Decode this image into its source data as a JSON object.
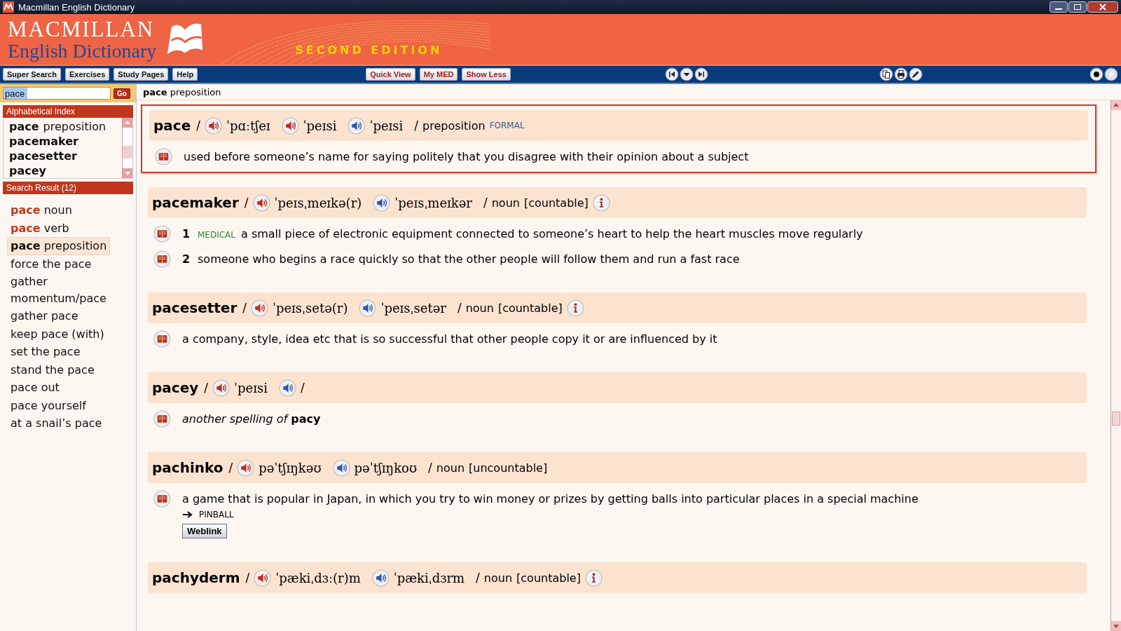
{
  "window": {
    "title": "Macmillan English Dictionary"
  },
  "banner": {
    "brand": "MACMILLAN",
    "subtitle": "English Dictionary",
    "edition": "SECOND EDITION"
  },
  "toolbar": {
    "left_buttons": [
      "Super Search",
      "Exercises",
      "Study Pages",
      "Help"
    ],
    "view_buttons": [
      "Quick View",
      "My MED",
      "Show Less"
    ]
  },
  "search": {
    "value": "pace",
    "button": "Go"
  },
  "current": {
    "headword": "pace",
    "pos": "preposition"
  },
  "alphabetical_index": {
    "title": "Alphabetical Index",
    "items": [
      {
        "headword": "pace",
        "pos": "preposition"
      },
      {
        "headword": "pacemaker"
      },
      {
        "headword": "pacesetter"
      },
      {
        "headword": "pacey"
      }
    ]
  },
  "search_result": {
    "title": "Search Result (12)",
    "items": [
      {
        "kind": "entry",
        "headword": "pace",
        "pos": "noun",
        "selected": false
      },
      {
        "kind": "entry",
        "headword": "pace",
        "pos": "verb",
        "selected": false
      },
      {
        "kind": "entry",
        "headword": "pace",
        "pos": "preposition",
        "selected": true
      },
      {
        "kind": "phrase",
        "text": "force the pace",
        "selected": false
      },
      {
        "kind": "phrase",
        "text": "gather momentum/pace",
        "selected": false
      },
      {
        "kind": "phrase",
        "text": "gather pace",
        "selected": false
      },
      {
        "kind": "phrase",
        "text": "keep pace (with)",
        "selected": false
      },
      {
        "kind": "phrase",
        "text": "set the pace",
        "selected": false
      },
      {
        "kind": "phrase",
        "text": "stand the pace",
        "selected": false
      },
      {
        "kind": "phrase",
        "text": "pace out",
        "selected": false
      },
      {
        "kind": "phrase",
        "text": "pace yourself",
        "selected": false
      },
      {
        "kind": "phrase",
        "text": "at a snail’s pace",
        "selected": false
      }
    ]
  },
  "entries": [
    {
      "headword": "pace",
      "selected": true,
      "slashes": [
        "/",
        "/"
      ],
      "pronunciations": [
        {
          "kind": "uk",
          "ipa": "ˈpɑːtʃeɪ"
        },
        {
          "kind": "uk",
          "ipa": "ˈpeɪsi"
        },
        {
          "kind": "us",
          "ipa": "ˈpeɪsi"
        }
      ],
      "pos": "preposition",
      "label": "FORMAL",
      "info": false,
      "senses": [
        {
          "text": "used before someone’s name for saying politely that you disagree with their opinion about a subject"
        }
      ]
    },
    {
      "headword": "pacemaker",
      "selected": false,
      "slashes": [
        "/",
        "/"
      ],
      "pronunciations": [
        {
          "kind": "uk",
          "ipa": "ˈpeɪsˌmeɪkə(r)"
        },
        {
          "kind": "us",
          "ipa": "ˈpeɪsˌmeɪkər"
        }
      ],
      "pos": "noun",
      "grammar": "[countable]",
      "info": true,
      "senses": [
        {
          "number": "1",
          "label": "MEDICAL",
          "text": "a small piece of electronic equipment connected to someone’s heart to help the heart muscles move regularly"
        },
        {
          "number": "2",
          "text": "someone who begins a race quickly so that the other people will follow them and run a fast race"
        }
      ]
    },
    {
      "headword": "pacesetter",
      "selected": false,
      "slashes": [
        "/",
        "/"
      ],
      "pronunciations": [
        {
          "kind": "uk",
          "ipa": "ˈpeɪsˌsetə(r)"
        },
        {
          "kind": "us",
          "ipa": "ˈpeɪsˌsetər"
        }
      ],
      "pos": "noun",
      "grammar": "[countable]",
      "info": true,
      "senses": [
        {
          "text": "a company, style, idea etc that is so successful that other people copy it or are influenced by it"
        }
      ]
    },
    {
      "headword": "pacey",
      "selected": false,
      "slashes": [
        "/",
        "/"
      ],
      "pronunciations": [
        {
          "kind": "uk",
          "ipa": "ˈpeɪsi"
        },
        {
          "kind": "us"
        }
      ],
      "info": false,
      "senses": [
        {
          "text": "*another spelling of* **pacy**"
        }
      ]
    },
    {
      "headword": "pachinko",
      "selected": false,
      "slashes": [
        "/",
        "/"
      ],
      "pronunciations": [
        {
          "kind": "uk",
          "ipa": "pəˈtʃɪŋkəʊ"
        },
        {
          "kind": "us",
          "ipa": "pəˈtʃɪŋkoʊ"
        }
      ],
      "pos": "noun",
      "grammar": "[uncountable]",
      "info": false,
      "senses": [
        {
          "text": "a game that is popular in Japan, in which you try to win money or prizes by getting balls into particular places in a special machine",
          "crossref": "PINBALL",
          "weblink": "Weblink"
        }
      ]
    },
    {
      "headword": "pachyderm",
      "selected": false,
      "slashes": [
        "/",
        "/"
      ],
      "pronunciations": [
        {
          "kind": "uk",
          "ipa": "ˈpækiˌdɜː(r)m"
        },
        {
          "kind": "us",
          "ipa": "ˈpækiˌdɜrm"
        }
      ],
      "pos": "noun",
      "grammar": "[countable]",
      "info": true
    }
  ]
}
